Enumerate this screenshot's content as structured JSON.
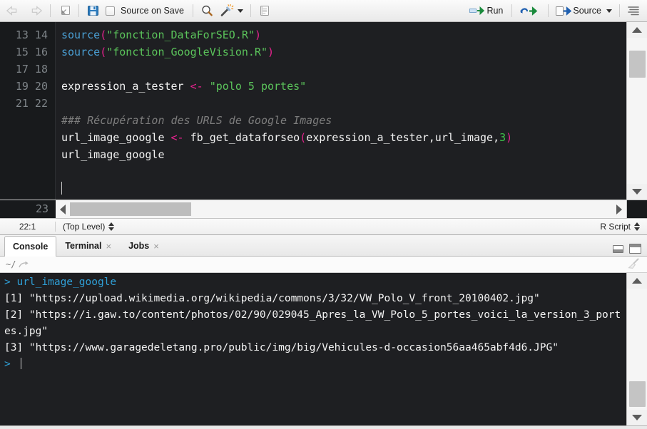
{
  "source_toolbar": {
    "back_icon": "back-arrow-icon",
    "forward_icon": "forward-arrow-icon",
    "popout_icon": "show-in-new-window-icon",
    "save_icon": "save-icon",
    "source_on_save_label": "Source on Save",
    "find_icon": "search-icon",
    "wand_icon": "code-tools-magic-wand-icon",
    "compile_report_icon": "compile-report-icon",
    "run_label": "Run",
    "run_icon": "run-icon",
    "rerun_icon": "re-run-icon",
    "source_label": "Source",
    "source_icon": "source-icon",
    "outline_icon": "document-outline-icon"
  },
  "editor": {
    "first_line": 13,
    "lines": [
      {
        "n": 13,
        "tokens": [
          {
            "t": "fn",
            "v": "source"
          },
          {
            "t": "par",
            "v": "("
          },
          {
            "t": "str",
            "v": "\"fonction_DataForSEO.R\""
          },
          {
            "t": "par",
            "v": ")"
          }
        ]
      },
      {
        "n": 14,
        "tokens": [
          {
            "t": "fn",
            "v": "source"
          },
          {
            "t": "par",
            "v": "("
          },
          {
            "t": "str",
            "v": "\"fonction_GoogleVision.R\""
          },
          {
            "t": "par",
            "v": ")"
          }
        ]
      },
      {
        "n": 15,
        "tokens": []
      },
      {
        "n": 16,
        "tokens": [
          {
            "t": "id",
            "v": "expression_a_tester "
          },
          {
            "t": "op",
            "v": "<-"
          },
          {
            "t": "id",
            "v": " "
          },
          {
            "t": "str",
            "v": "\"polo 5 portes\""
          }
        ]
      },
      {
        "n": 17,
        "tokens": []
      },
      {
        "n": 18,
        "tokens": [
          {
            "t": "com",
            "v": "### Récupération des URLS de Google Images"
          }
        ]
      },
      {
        "n": 19,
        "tokens": [
          {
            "t": "id",
            "v": "url_image_google "
          },
          {
            "t": "op",
            "v": "<-"
          },
          {
            "t": "id",
            "v": " fb_get_dataforseo"
          },
          {
            "t": "par",
            "v": "("
          },
          {
            "t": "id",
            "v": "expression_a_tester,url_image,"
          },
          {
            "t": "num",
            "v": "3"
          },
          {
            "t": "par",
            "v": ")"
          }
        ]
      },
      {
        "n": 20,
        "tokens": [
          {
            "t": "id",
            "v": "url_image_google"
          }
        ]
      },
      {
        "n": 21,
        "tokens": []
      },
      {
        "n": 22,
        "tokens": [],
        "cursor": true
      },
      {
        "n": 23,
        "tokens": []
      }
    ]
  },
  "source_status": {
    "cursor_position": "22:1",
    "scope": "(Top Level)",
    "file_type": "R Script"
  },
  "console_tabs": [
    {
      "label": "Console",
      "active": true,
      "closable": false
    },
    {
      "label": "Terminal",
      "active": false,
      "closable": true
    },
    {
      "label": "Jobs",
      "active": false,
      "closable": true
    }
  ],
  "console_controls": {
    "minimize_icon": "minimize-pane-icon",
    "maximize_icon": "maximize-pane-icon"
  },
  "console_path": {
    "working_directory": "~/",
    "open_dir_icon": "open-directory-icon",
    "clear_icon": "clear-console-broom-icon"
  },
  "console_output": [
    {
      "type": "command",
      "prompt": "> ",
      "text": "url_image_google"
    },
    {
      "type": "output",
      "text": "[1] \"https://upload.wikimedia.org/wikipedia/commons/3/32/VW_Polo_V_front_20100402.jpg\""
    },
    {
      "type": "output",
      "text": "[2] \"https://i.gaw.to/content/photos/02/90/029045_Apres_la_VW_Polo_5_portes_voici_la_version_3_portes.jpg\""
    },
    {
      "type": "output",
      "text": "[3] \"https://www.garagedeletang.pro/public/img/big/Vehicules-d-occasion56aa465abf4d6.JPG\""
    },
    {
      "type": "prompt",
      "prompt": "> ",
      "text": ""
    }
  ],
  "colors": {
    "editor_bg": "#1e1f22",
    "gutter_bg": "#181a1c",
    "string": "#5bc45b",
    "function": "#4a9fd4",
    "operator": "#e8228f",
    "comment": "#7d7d7d",
    "number": "#3ec24a",
    "prompt": "#2f9fd6",
    "chrome": "#f1f1f1"
  }
}
